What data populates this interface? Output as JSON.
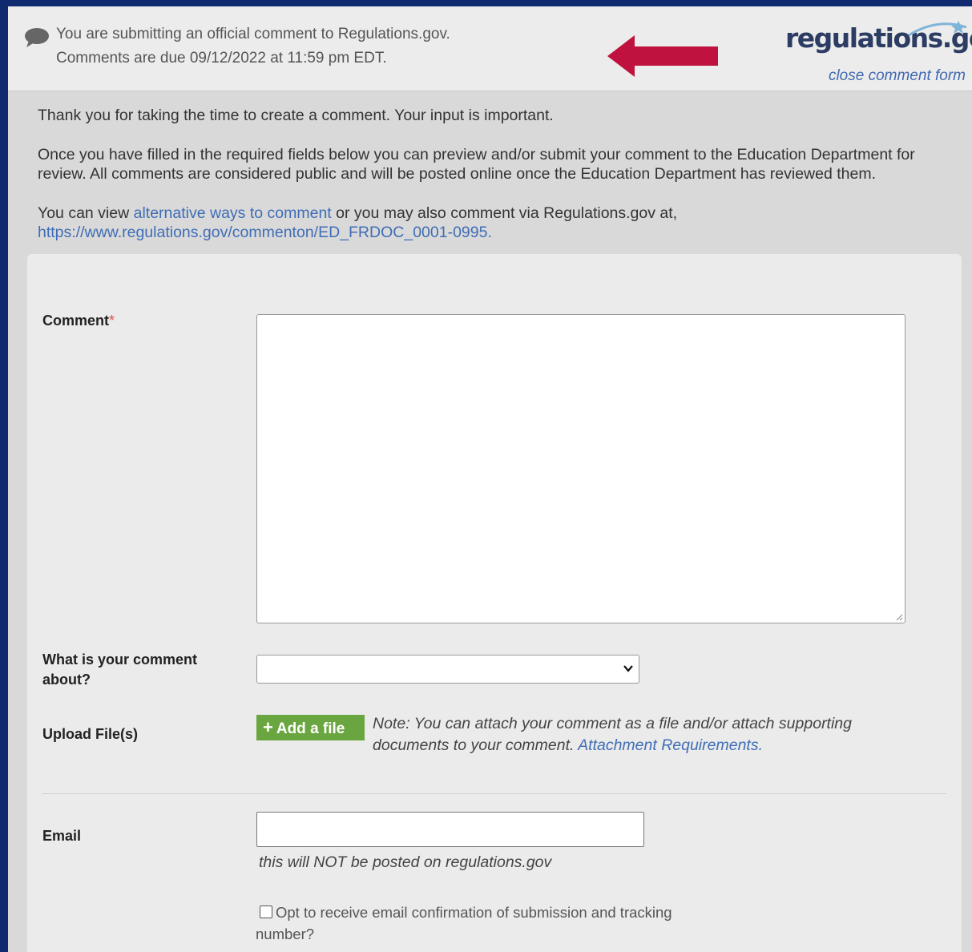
{
  "banner": {
    "line1": "You are submitting an official comment to Regulations.gov.",
    "line2": "Comments are due 09/12/2022 at 11:59 pm EDT.",
    "logo_text": "regulations.gov",
    "close_link": "close comment form",
    "arrow_color": "#c0123e"
  },
  "intro": {
    "p1": "Thank you for taking the time to create a comment. Your input is important.",
    "p2": "Once you have filled in the required fields below you can preview and/or submit your comment to the Education Department for review. All comments are considered public and will be posted online once the Education Department has reviewed them.",
    "p3_prefix": "You can view ",
    "p3_link": "alternative ways to comment",
    "p3_middle": " or you may also comment via Regulations.gov at,",
    "p3_url": "https://www.regulations.gov/commenton/ED_FRDOC_0001-0995",
    "p3_suffix": "."
  },
  "form": {
    "comment_label": "Comment",
    "required_mark": "*",
    "about_label_line1": "What is your comment",
    "about_label_line2": "about?",
    "about_selected": "",
    "upload_label": "Upload File(s)",
    "add_file_button": "Add a file",
    "note_text": "Note: You can attach your comment as a file and/or attach supporting documents to your comment. ",
    "note_link": "Attachment Requirements",
    "note_suffix": ".",
    "email_label": "Email",
    "email_value": "",
    "email_help": "this will NOT be posted on regulations.gov",
    "optin_text": "Opt to receive email confirmation of submission and tracking number?"
  },
  "colors": {
    "frame": "#0f2a6e",
    "link": "#3f6db5",
    "add_button": "#6aa63f",
    "required": "#d9534f"
  }
}
